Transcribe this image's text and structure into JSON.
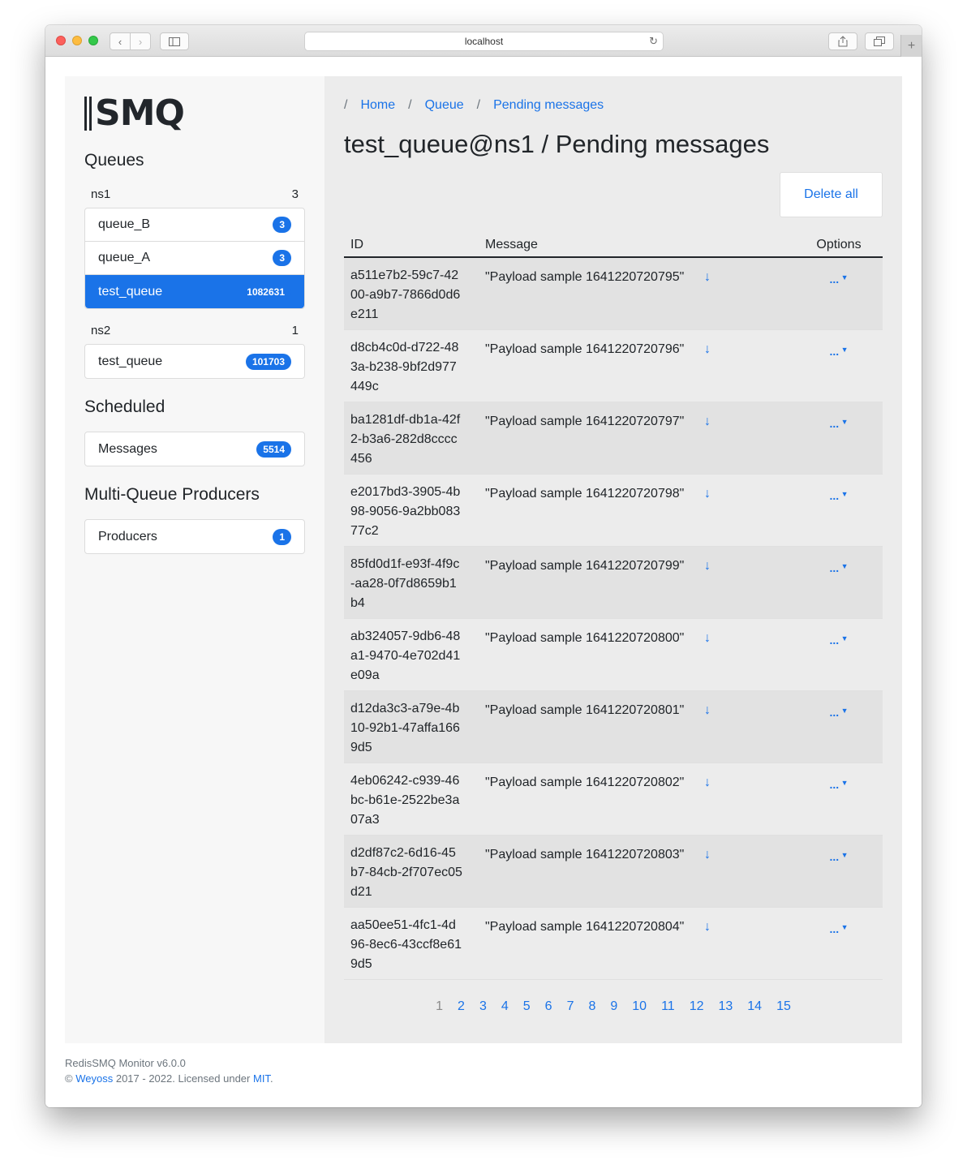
{
  "browser": {
    "url": "localhost"
  },
  "logo": {
    "text": "SMQ"
  },
  "sidebar": {
    "queues_heading": "Queues",
    "namespaces": [
      {
        "name": "ns1",
        "count": "3",
        "queues": [
          {
            "name": "queue_B",
            "count": "3"
          },
          {
            "name": "queue_A",
            "count": "3"
          },
          {
            "name": "test_queue",
            "count": "1082631",
            "active": true
          }
        ]
      },
      {
        "name": "ns2",
        "count": "1",
        "queues": [
          {
            "name": "test_queue",
            "count": "101703"
          }
        ]
      }
    ],
    "scheduled_heading": "Scheduled",
    "scheduled_item": {
      "label": "Messages",
      "count": "5514"
    },
    "producers_heading": "Multi-Queue Producers",
    "producers_item": {
      "label": "Producers",
      "count": "1"
    }
  },
  "breadcrumb": {
    "separator": "/",
    "items": [
      "Home",
      "Queue",
      "Pending messages"
    ]
  },
  "page_title": "test_queue@ns1 / Pending messages",
  "delete_all_label": "Delete all",
  "table": {
    "headers": {
      "id": "ID",
      "message": "Message",
      "options": "Options"
    },
    "options_label": "...",
    "rows": [
      {
        "id": "a511e7b2-59c7-4200-a9b7-7866d0d6e211",
        "message": "\"Payload sample 1641220720795\""
      },
      {
        "id": "d8cb4c0d-d722-483a-b238-9bf2d977449c",
        "message": "\"Payload sample 1641220720796\""
      },
      {
        "id": "ba1281df-db1a-42f2-b3a6-282d8cccc456",
        "message": "\"Payload sample 1641220720797\""
      },
      {
        "id": "e2017bd3-3905-4b98-9056-9a2bb08377c2",
        "message": "\"Payload sample 1641220720798\""
      },
      {
        "id": "85fd0d1f-e93f-4f9c-aa28-0f7d8659b1b4",
        "message": "\"Payload sample 1641220720799\""
      },
      {
        "id": "ab324057-9db6-48a1-9470-4e702d41e09a",
        "message": "\"Payload sample 1641220720800\""
      },
      {
        "id": "d12da3c3-a79e-4b10-92b1-47affa1669d5",
        "message": "\"Payload sample 1641220720801\""
      },
      {
        "id": "4eb06242-c939-46bc-b61e-2522be3a07a3",
        "message": "\"Payload sample 1641220720802\""
      },
      {
        "id": "d2df87c2-6d16-45b7-84cb-2f707ec05d21",
        "message": "\"Payload sample 1641220720803\""
      },
      {
        "id": "aa50ee51-4fc1-4d96-8ec6-43ccf8e619d5",
        "message": "\"Payload sample 1641220720804\""
      }
    ]
  },
  "pagination": {
    "current": "1",
    "pages": [
      "1",
      "2",
      "3",
      "4",
      "5",
      "6",
      "7",
      "8",
      "9",
      "10",
      "11",
      "12",
      "13",
      "14",
      "15"
    ]
  },
  "footer": {
    "version": "RedisSMQ Monitor v6.0.0",
    "copyright_symbol": "©",
    "author": "Weyoss",
    "years_text": "2017 - 2022. Licensed under",
    "license": "MIT",
    "period": "."
  },
  "colors": {
    "accent": "#1a73e8",
    "sidebar_bg": "#f7f7f7",
    "main_bg": "#ececec"
  }
}
